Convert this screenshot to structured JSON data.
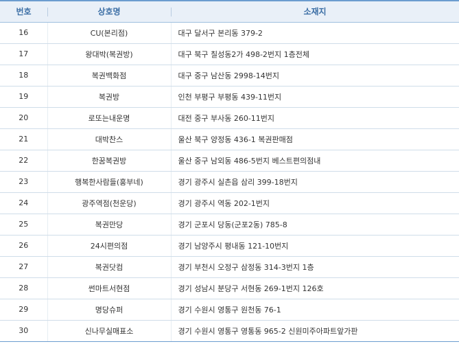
{
  "table": {
    "headers": {
      "number": "번호",
      "name": "상호명",
      "address": "소재지"
    },
    "rows": [
      {
        "number": "16",
        "name": "CU(본리점)",
        "address": "대구 달서구 본리동 379-2"
      },
      {
        "number": "17",
        "name": "왕대박(복권방)",
        "address": "대구 북구 칠성동2가 498-2번지 1층전체"
      },
      {
        "number": "18",
        "name": "복권백화점",
        "address": "대구 중구 남산동 2998-14번지"
      },
      {
        "number": "19",
        "name": "복권방",
        "address": "인천 부평구 부평동 439-11번지"
      },
      {
        "number": "20",
        "name": "로또는내운명",
        "address": "대전 중구 부사동 260-11번지"
      },
      {
        "number": "21",
        "name": "대박찬스",
        "address": "울산 북구 양정동 436-1 복권판매점"
      },
      {
        "number": "22",
        "name": "한꿈복권방",
        "address": "울산 중구 남외동 486-5번지 베스트편의점내"
      },
      {
        "number": "23",
        "name": "행복한사람들(홍부네)",
        "address": "경기 광주시 실촌읍 삼리 399-18번지"
      },
      {
        "number": "24",
        "name": "광주역점(천운당)",
        "address": "경기 광주시 역동 202-1번지"
      },
      {
        "number": "25",
        "name": "복권만당",
        "address": "경기 군포시 당동(군포2동) 785-8"
      },
      {
        "number": "26",
        "name": "24시편의점",
        "address": "경기 남양주시 평내동 121-10번지"
      },
      {
        "number": "27",
        "name": "복권닷컴",
        "address": "경기 부천시 오정구 삼정동 314-3번지 1층"
      },
      {
        "number": "28",
        "name": "썬마트서현점",
        "address": "경기 성남시 분당구 서현동 269-1번지 126호"
      },
      {
        "number": "29",
        "name": "명당슈퍼",
        "address": "경기 수원시 영통구 원천동 76-1"
      },
      {
        "number": "30",
        "name": "신나무실매표소",
        "address": "경기 수원시 영통구 영통동 965-2 신원미주아파트앞가판"
      }
    ]
  }
}
